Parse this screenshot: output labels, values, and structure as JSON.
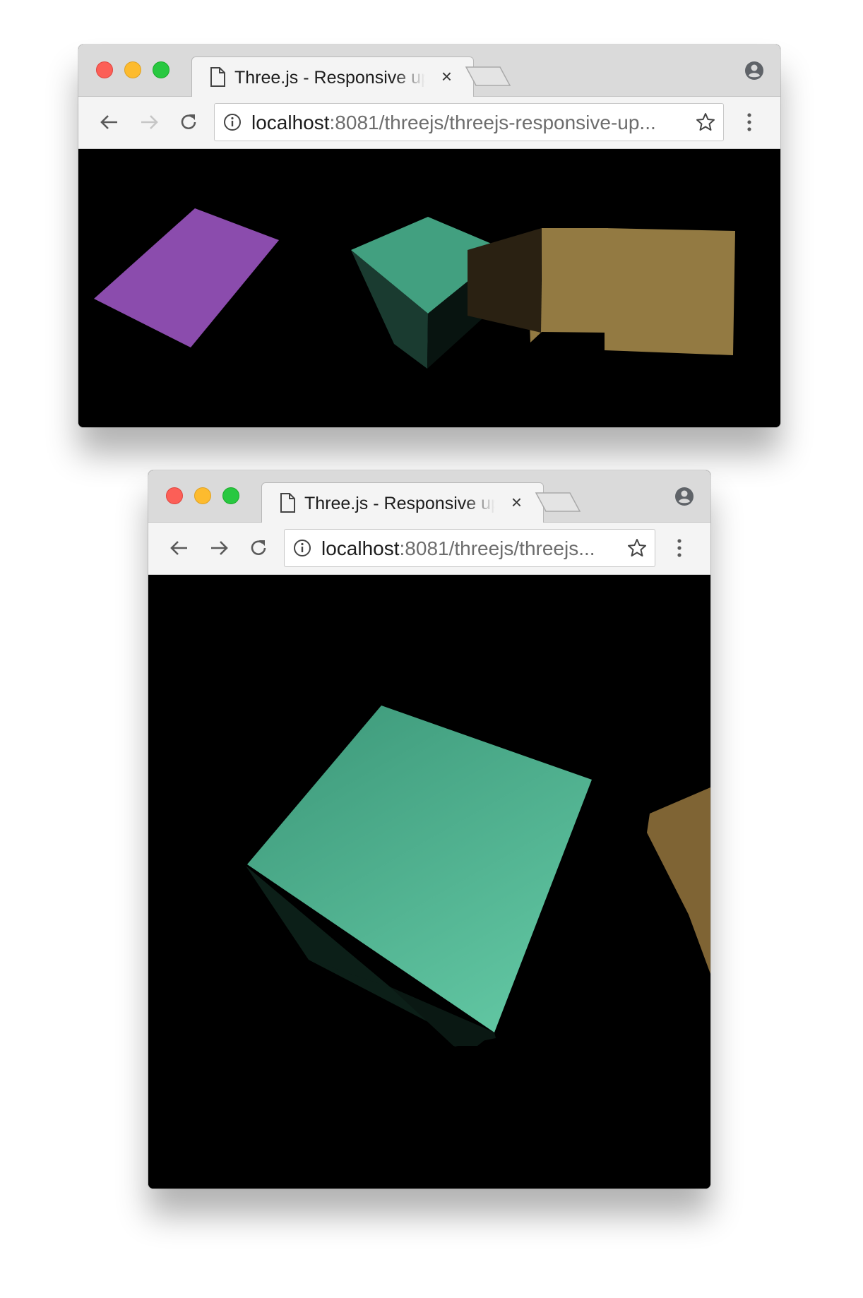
{
  "windows": [
    {
      "tab": {
        "title": "Three.js - Responsive update",
        "close_label": "×"
      },
      "address_bar": {
        "host": "localhost",
        "path": ":8081/threejs/threejs-responsive-up..."
      }
    },
    {
      "tab": {
        "title": "Three.js - Responsive update",
        "close_label": "×"
      },
      "address_bar": {
        "host": "localhost",
        "path": ":8081/threejs/threejs..."
      }
    }
  ],
  "icons": {
    "tab": "document-icon",
    "close": "close-icon",
    "new_tab": "new-tab-icon",
    "profile": "profile-icon",
    "back": "back-arrow-icon",
    "forward": "forward-arrow-icon",
    "reload": "reload-icon",
    "info": "info-icon",
    "bookmark": "star-icon",
    "menu": "more-vertical-icon"
  },
  "colors": {
    "close_red": "#fc5f57",
    "minimize_yellow": "#fdbb2e",
    "zoom_green": "#28c840",
    "purple_shape": "#8b4cad",
    "teal_cube": "#42a080",
    "gold_cube": "#937a42",
    "canvas_background": "#000000"
  }
}
